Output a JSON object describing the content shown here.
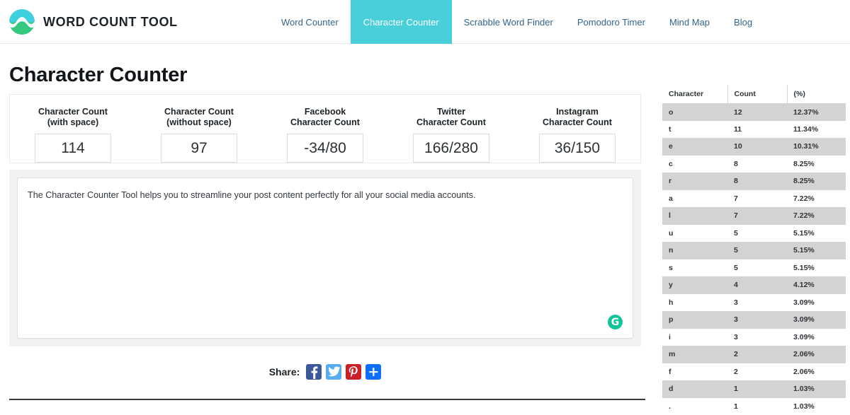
{
  "brand": {
    "name": "WORD COUNT TOOL",
    "logo_icon": "wave-circle-logo",
    "logo_colors": {
      "top": "#3ed0de",
      "bottom": "#34c97f"
    }
  },
  "nav": {
    "items": [
      {
        "label": "Word Counter",
        "active": false
      },
      {
        "label": "Character Counter",
        "active": true
      },
      {
        "label": "Scrabble Word Finder",
        "active": false
      },
      {
        "label": "Pomodoro Timer",
        "active": false
      },
      {
        "label": "Mind Map",
        "active": false
      },
      {
        "label": "Blog",
        "active": false
      }
    ],
    "active_bg": "#49cfd9",
    "link_color": "#33658a"
  },
  "page": {
    "title": "Character Counter"
  },
  "counters": [
    {
      "label": "Character Count\n(with space)",
      "value": "114"
    },
    {
      "label": "Character Count\n(without space)",
      "value": "97"
    },
    {
      "label": "Facebook\nCharacter Count",
      "value": "-34/80"
    },
    {
      "label": "Twitter\nCharacter Count",
      "value": "166/280"
    },
    {
      "label": "Instagram\nCharacter Count",
      "value": "36/150"
    }
  ],
  "editor": {
    "text": "The Character Counter Tool helps you to streamline your post content perfectly for all your social media accounts.",
    "placeholder": "",
    "grammarly_icon": "grammarly-icon",
    "grammarly_glyph": "G",
    "grammarly_color": "#15c39a"
  },
  "share": {
    "label": "Share:",
    "buttons": [
      {
        "name": "facebook",
        "icon": "facebook-icon",
        "color": "#3b5998"
      },
      {
        "name": "twitter",
        "icon": "twitter-icon",
        "color": "#55acee"
      },
      {
        "name": "pinterest",
        "icon": "pinterest-icon",
        "color": "#cb2027"
      },
      {
        "name": "addthis",
        "icon": "plus-icon",
        "color": "#0e6fff",
        "glyph": "+"
      }
    ]
  },
  "frequency_table": {
    "columns": [
      "Character",
      "Count",
      "(%)"
    ],
    "rows": [
      {
        "character": "o",
        "count": "12",
        "percent": "12.37%"
      },
      {
        "character": "t",
        "count": "11",
        "percent": "11.34%"
      },
      {
        "character": "e",
        "count": "10",
        "percent": "10.31%"
      },
      {
        "character": "c",
        "count": "8",
        "percent": "8.25%"
      },
      {
        "character": "r",
        "count": "8",
        "percent": "8.25%"
      },
      {
        "character": "a",
        "count": "7",
        "percent": "7.22%"
      },
      {
        "character": "l",
        "count": "7",
        "percent": "7.22%"
      },
      {
        "character": "u",
        "count": "5",
        "percent": "5.15%"
      },
      {
        "character": "n",
        "count": "5",
        "percent": "5.15%"
      },
      {
        "character": "s",
        "count": "5",
        "percent": "5.15%"
      },
      {
        "character": "y",
        "count": "4",
        "percent": "4.12%"
      },
      {
        "character": "h",
        "count": "3",
        "percent": "3.09%"
      },
      {
        "character": "p",
        "count": "3",
        "percent": "3.09%"
      },
      {
        "character": "i",
        "count": "3",
        "percent": "3.09%"
      },
      {
        "character": "m",
        "count": "2",
        "percent": "2.06%"
      },
      {
        "character": "f",
        "count": "2",
        "percent": "2.06%"
      },
      {
        "character": "d",
        "count": "1",
        "percent": "1.03%"
      },
      {
        "character": ".",
        "count": "1",
        "percent": "1.03%"
      }
    ]
  }
}
